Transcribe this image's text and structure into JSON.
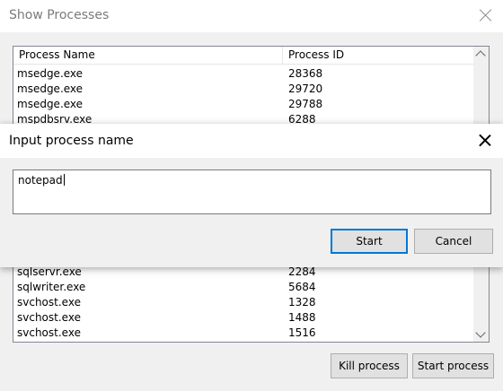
{
  "main_window": {
    "title": "Show Processes",
    "columns": [
      "Process Name",
      "Process ID"
    ],
    "rows_top": [
      {
        "name": "msedge.exe",
        "pid": "28368"
      },
      {
        "name": "msedge.exe",
        "pid": "29720"
      },
      {
        "name": "msedge.exe",
        "pid": "29788"
      },
      {
        "name": "mspdbsrv.exe",
        "pid": "6288"
      }
    ],
    "rows_bottom": [
      {
        "name": "sqlservr.exe",
        "pid": "2284"
      },
      {
        "name": "sqlwriter.exe",
        "pid": "5684"
      },
      {
        "name": "svchost.exe",
        "pid": "1328"
      },
      {
        "name": "svchost.exe",
        "pid": "1488"
      },
      {
        "name": "svchost.exe",
        "pid": "1516"
      }
    ],
    "kill_label": "Kill process",
    "start_label": "Start process"
  },
  "dialog": {
    "title": "Input process name",
    "input_value": "notepad",
    "start_label": "Start",
    "cancel_label": "Cancel"
  }
}
